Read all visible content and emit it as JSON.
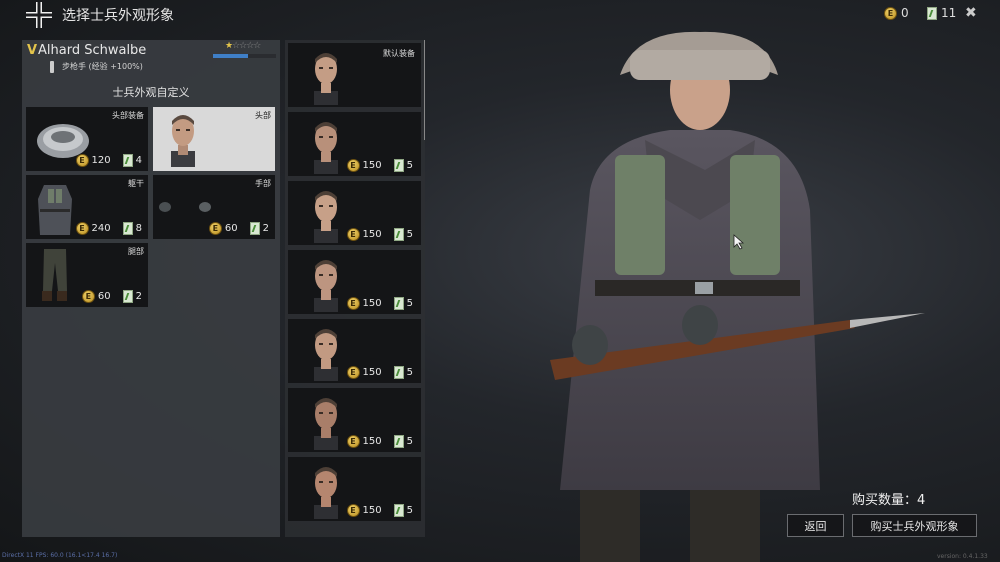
{
  "header": {
    "title": "选择士兵外观形象",
    "silver": "0",
    "tickets": "11"
  },
  "soldier": {
    "rank": "V",
    "name": "Alhard Schwalbe",
    "class_line": "步枪手 (经验 +100%)",
    "stars_filled": "★",
    "stars_empty": "☆☆☆☆",
    "xp_progress_percent": 55
  },
  "customize": {
    "title": "士兵外观自定义",
    "slots": [
      {
        "label": "头部装备",
        "cost": "120",
        "tickets": "4"
      },
      {
        "label": "头部",
        "cost": "",
        "tickets": ""
      },
      {
        "label": "躯干",
        "cost": "240",
        "tickets": "8"
      },
      {
        "label": "手部",
        "cost": "60",
        "tickets": "2"
      },
      {
        "label": "腿部",
        "cost": "60",
        "tickets": "2"
      }
    ]
  },
  "heads": [
    {
      "label": "默认装备",
      "cost": "",
      "tickets": ""
    },
    {
      "label": "",
      "cost": "150",
      "tickets": "5"
    },
    {
      "label": "",
      "cost": "150",
      "tickets": "5"
    },
    {
      "label": "",
      "cost": "150",
      "tickets": "5"
    },
    {
      "label": "",
      "cost": "150",
      "tickets": "5"
    },
    {
      "label": "",
      "cost": "150",
      "tickets": "5"
    },
    {
      "label": "",
      "cost": "150",
      "tickets": "5"
    }
  ],
  "purchase": {
    "quantity_label": "购买数量：4",
    "back_label": "返回",
    "buy_label": "购买士兵外观形象"
  },
  "footer": {
    "debug": "DirectX 11 FPS: 60.0 (16.1<17.4 16.7)",
    "version": "version: 0.4.1.33"
  }
}
